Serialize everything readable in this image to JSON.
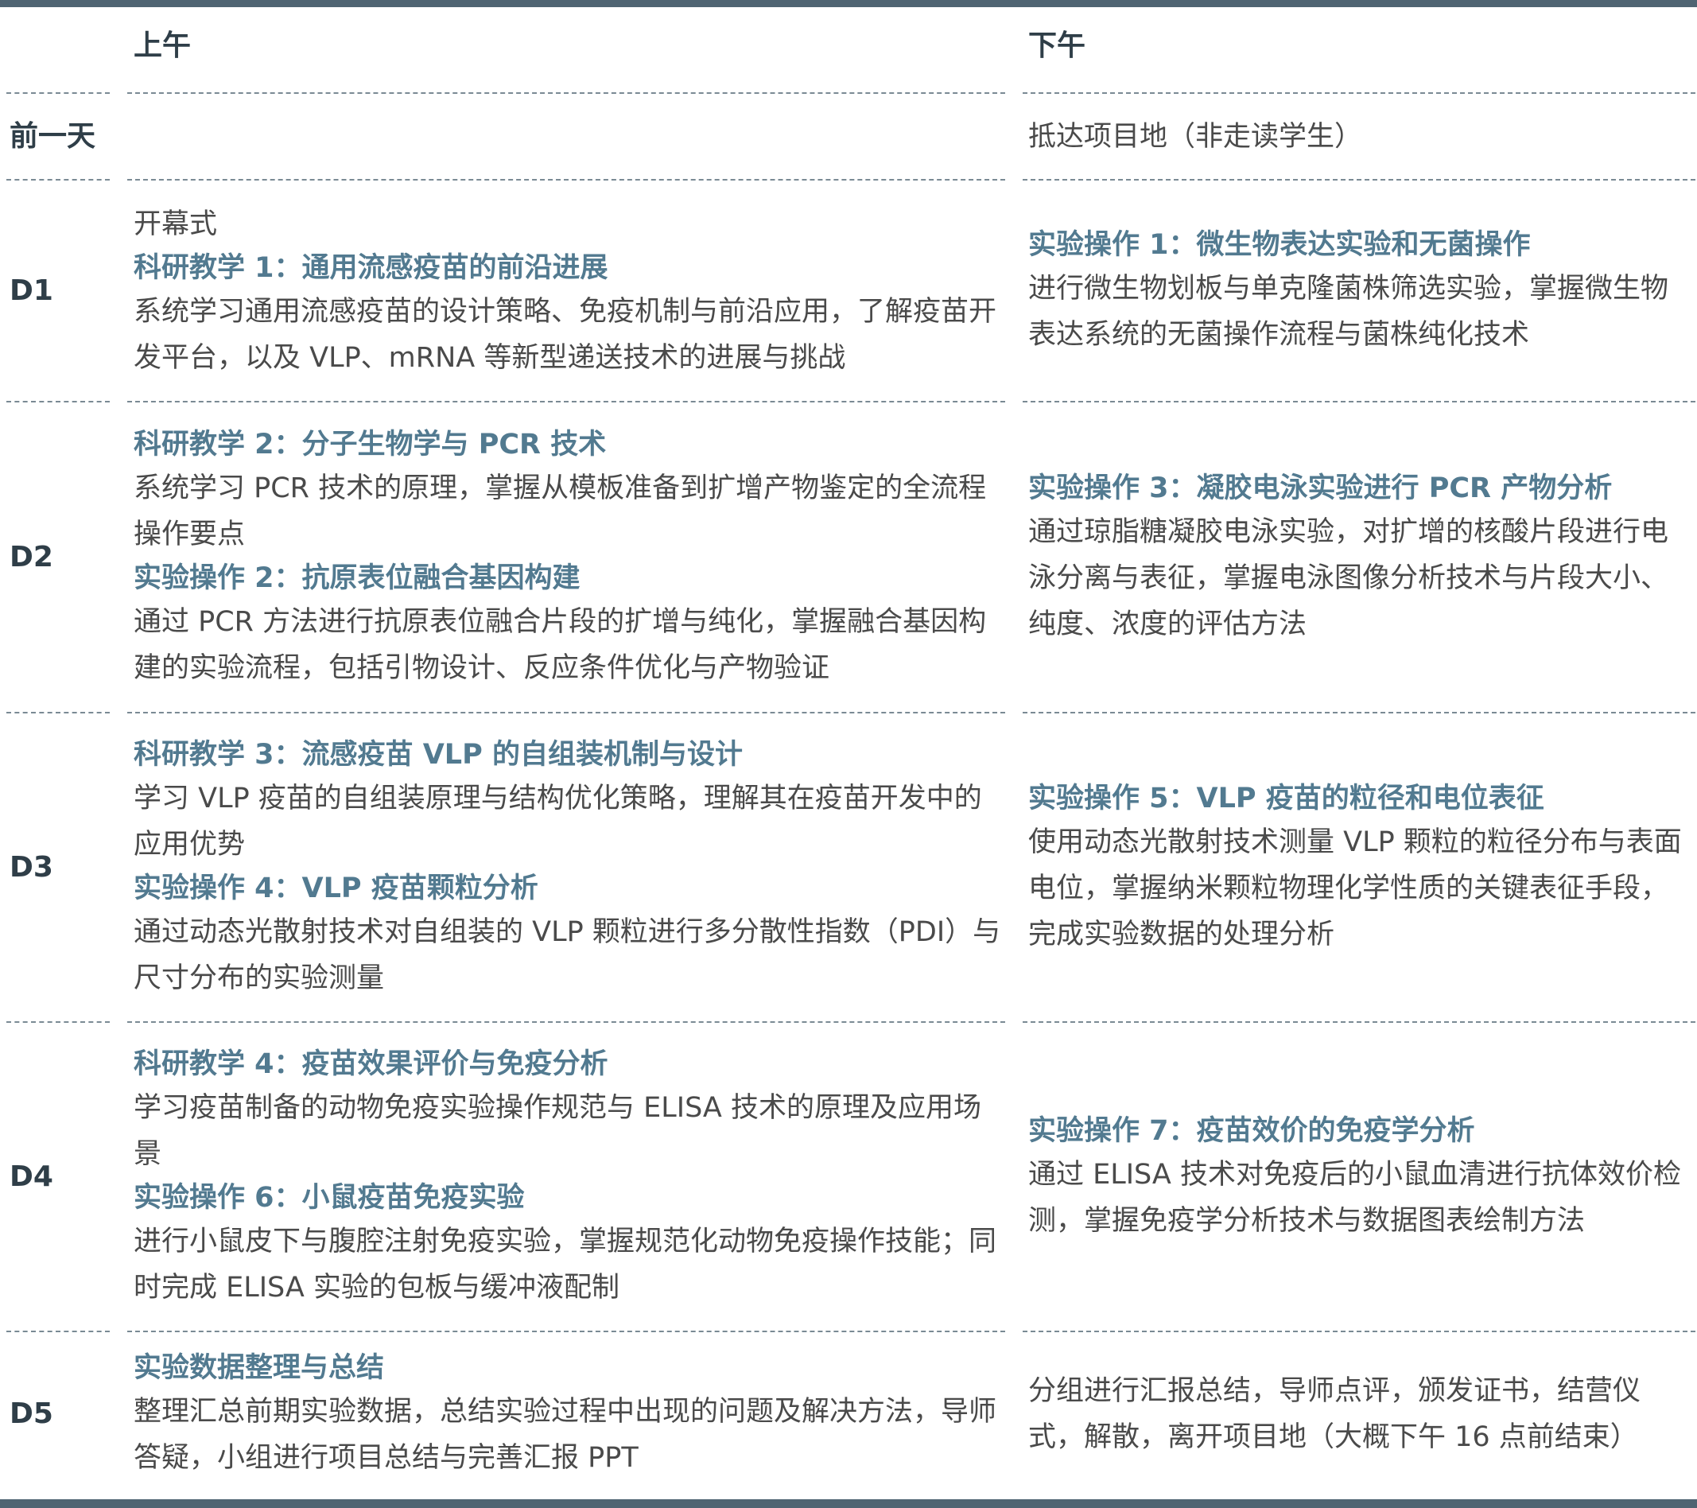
{
  "header": {
    "morning": "上午",
    "afternoon": "下午"
  },
  "rows": [
    {
      "day": "前一天",
      "morning": [],
      "afternoon": [
        {
          "kind": "text",
          "text": "抵达项目地（非走读学生）"
        }
      ]
    },
    {
      "day": "D1",
      "morning": [
        {
          "kind": "text",
          "text": "开幕式"
        },
        {
          "kind": "title",
          "text": "科研教学 1：通用流感疫苗的前沿进展"
        },
        {
          "kind": "text",
          "text": "系统学习通用流感疫苗的设计策略、免疫机制与前沿应用，了解疫苗开发平台，以及 VLP、mRNA 等新型递送技术的进展与挑战"
        }
      ],
      "afternoon": [
        {
          "kind": "title",
          "text": "实验操作 1：微生物表达实验和无菌操作"
        },
        {
          "kind": "text",
          "text": "进行微生物划板与单克隆菌株筛选实验，掌握微生物表达系统的无菌操作流程与菌株纯化技术"
        }
      ]
    },
    {
      "day": "D2",
      "morning": [
        {
          "kind": "title",
          "text": "科研教学 2：分子生物学与 PCR 技术"
        },
        {
          "kind": "text",
          "text": "系统学习 PCR 技术的原理，掌握从模板准备到扩增产物鉴定的全流程操作要点"
        },
        {
          "kind": "title",
          "text": "实验操作 2：抗原表位融合基因构建"
        },
        {
          "kind": "text",
          "text": "通过 PCR 方法进行抗原表位融合片段的扩增与纯化，掌握融合基因构建的实验流程，包括引物设计、反应条件优化与产物验证"
        }
      ],
      "afternoon": [
        {
          "kind": "title",
          "text": "实验操作 3：凝胶电泳实验进行 PCR 产物分析"
        },
        {
          "kind": "text",
          "text": "通过琼脂糖凝胶电泳实验，对扩增的核酸片段进行电泳分离与表征，掌握电泳图像分析技术与片段大小、纯度、浓度的评估方法"
        }
      ]
    },
    {
      "day": "D3",
      "morning": [
        {
          "kind": "title",
          "text": "科研教学 3：流感疫苗 VLP 的自组装机制与设计"
        },
        {
          "kind": "text",
          "text": "学习 VLP 疫苗的自组装原理与结构优化策略，理解其在疫苗开发中的应用优势"
        },
        {
          "kind": "title",
          "text": "实验操作 4：VLP 疫苗颗粒分析"
        },
        {
          "kind": "text",
          "text": "通过动态光散射技术对自组装的 VLP 颗粒进行多分散性指数（PDI）与尺寸分布的实验测量"
        }
      ],
      "afternoon": [
        {
          "kind": "title",
          "text": "实验操作 5：VLP 疫苗的粒径和电位表征"
        },
        {
          "kind": "text",
          "text": "使用动态光散射技术测量 VLP 颗粒的粒径分布与表面电位，掌握纳米颗粒物理化学性质的关键表征手段，完成实验数据的处理分析"
        }
      ]
    },
    {
      "day": "D4",
      "morning": [
        {
          "kind": "title",
          "text": "科研教学 4：疫苗效果评价与免疫分析"
        },
        {
          "kind": "text",
          "text": "学习疫苗制备的动物免疫实验操作规范与 ELISA 技术的原理及应用场景"
        },
        {
          "kind": "title",
          "text": "实验操作 6：小鼠疫苗免疫实验"
        },
        {
          "kind": "text",
          "text": "进行小鼠皮下与腹腔注射免疫实验，掌握规范化动物免疫操作技能；同时完成 ELISA 实验的包板与缓冲液配制"
        }
      ],
      "afternoon": [
        {
          "kind": "title",
          "text": "实验操作 7：疫苗效价的免疫学分析"
        },
        {
          "kind": "text",
          "text": "通过 ELISA 技术对免疫后的小鼠血清进行抗体效价检测，掌握免疫学分析技术与数据图表绘制方法"
        }
      ]
    },
    {
      "day": "D5",
      "morning": [
        {
          "kind": "title",
          "text": "实验数据整理与总结"
        },
        {
          "kind": "text",
          "text": "整理汇总前期实验数据，总结实验过程中出现的问题及解决方法，导师答疑，小组进行项目总结与完善汇报 PPT"
        }
      ],
      "afternoon": [
        {
          "kind": "text",
          "text": "分组进行汇报总结，导师点评，颁发证书，结营仪式，解散，离开项目地（大概下午 16 点前结束）"
        }
      ]
    }
  ]
}
